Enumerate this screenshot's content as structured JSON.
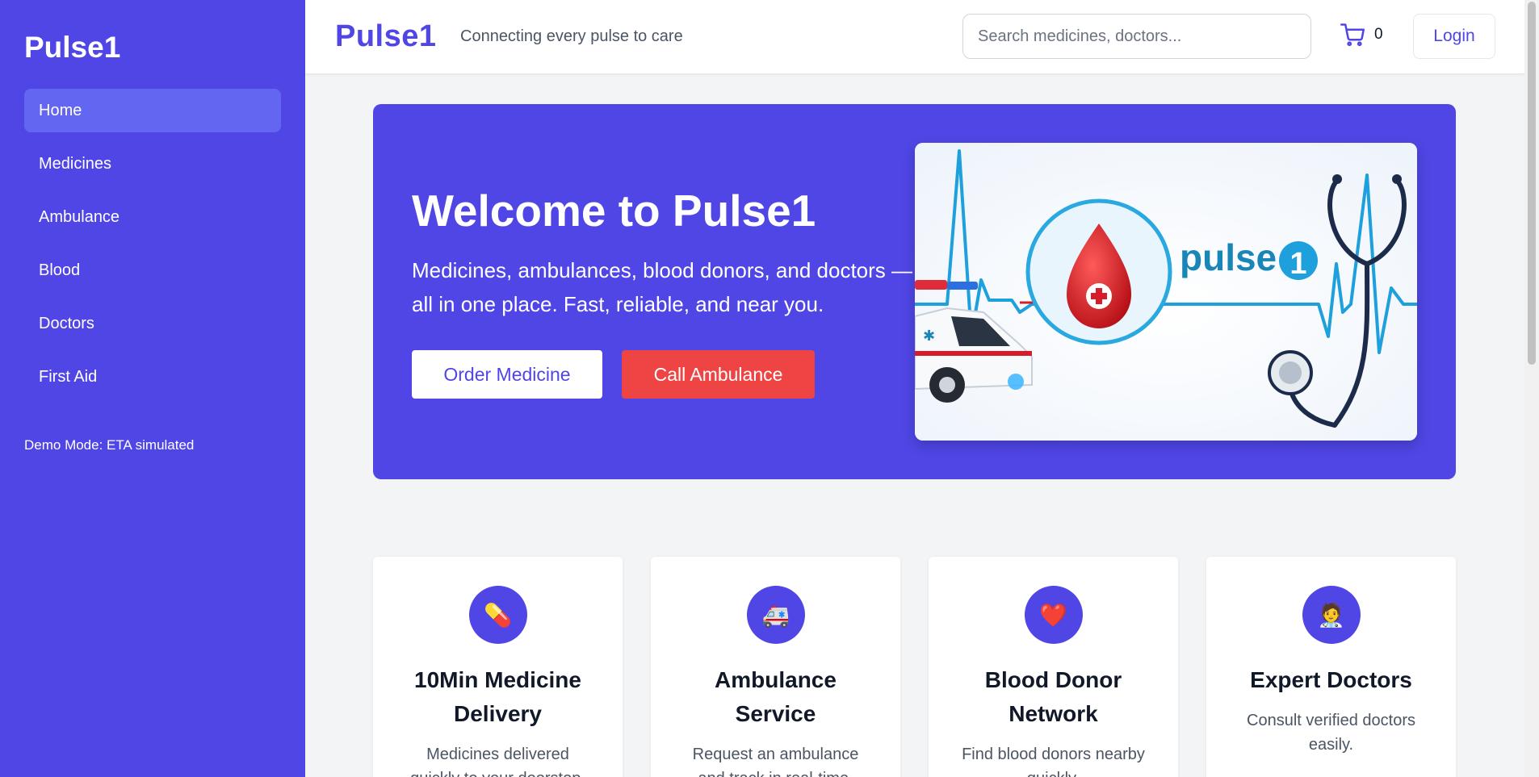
{
  "sidebar": {
    "brand": "Pulse1",
    "items": [
      {
        "label": "Home"
      },
      {
        "label": "Medicines"
      },
      {
        "label": "Ambulance"
      },
      {
        "label": "Blood"
      },
      {
        "label": "Doctors"
      },
      {
        "label": "First Aid"
      }
    ],
    "active_item": "Home",
    "demo_note": "Demo Mode: ETA simulated"
  },
  "header": {
    "logo": "Pulse1",
    "tagline": "Connecting every pulse to care",
    "search_placeholder": "Search medicines, doctors...",
    "cart_icon": "cart-icon",
    "cart_count": "0",
    "login_label": "Login"
  },
  "hero": {
    "title": "Welcome to Pulse1",
    "subtitle": "Medicines, ambulances, blood donors, and doctors — all in one place. Fast, reliable, and near you.",
    "order_button": "Order Medicine",
    "ambulance_button": "Call Ambulance",
    "image_logo_text": "pulse",
    "image_logo_badge": "1"
  },
  "features": [
    {
      "icon": "pill-icon",
      "glyph": "💊",
      "title": "10Min Medicine Delivery",
      "desc": "Medicines delivered quickly to your doorstep."
    },
    {
      "icon": "ambulance-icon",
      "glyph": "🚑",
      "title": "Ambulance Service",
      "desc": "Request an ambulance and track in real-time."
    },
    {
      "icon": "heart-icon",
      "glyph": "❤️",
      "title": "Blood Donor Network",
      "desc": "Find blood donors nearby quickly."
    },
    {
      "icon": "doctor-icon",
      "glyph": "🧑‍⚕️",
      "title": "Expert Doctors",
      "desc": "Consult verified doctors easily."
    }
  ],
  "colors": {
    "primary": "#4f46e5",
    "active_nav": "#6366f1",
    "danger": "#ef4444",
    "background": "#f3f4f6"
  }
}
